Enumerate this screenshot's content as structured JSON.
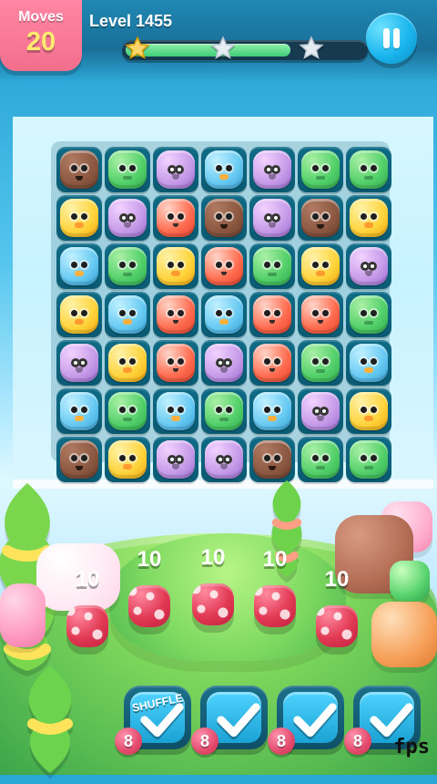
{
  "hud": {
    "moves_label": "Moves",
    "moves_value": "20",
    "level_label": "Level 1455",
    "progress_fraction": 0.69,
    "stars": [
      "gold",
      "silver",
      "silver"
    ]
  },
  "board": {
    "rows": 7,
    "cols": 7,
    "pieces": [
      [
        "bear",
        "frog",
        "owl",
        "bird",
        "owl",
        "frog",
        "frog"
      ],
      [
        "chick",
        "owl",
        "fox",
        "bear",
        "owl",
        "bear",
        "chick"
      ],
      [
        "bird",
        "frog",
        "chick",
        "fox",
        "frog",
        "chick",
        "owl"
      ],
      [
        "chick",
        "bird",
        "fox",
        "bird",
        "fox",
        "fox",
        "frog"
      ],
      [
        "owl",
        "chick",
        "fox",
        "owl",
        "fox",
        "frog",
        "bird"
      ],
      [
        "bird",
        "frog",
        "bird",
        "frog",
        "bird",
        "owl",
        "chick"
      ],
      [
        "bear",
        "chick",
        "owl",
        "owl",
        "bear",
        "frog",
        "frog"
      ]
    ]
  },
  "goals": {
    "items": [
      {
        "count": "10"
      },
      {
        "count": "10"
      },
      {
        "count": "10"
      },
      {
        "count": "10"
      },
      {
        "count": "10"
      }
    ]
  },
  "boosters": {
    "items": [
      {
        "label": "SHUFFLE",
        "count": "8"
      },
      {
        "label": "",
        "count": "8"
      },
      {
        "label": "",
        "count": "8"
      },
      {
        "label": "",
        "count": "8"
      }
    ]
  },
  "overlay": {
    "fps_label": "fps"
  },
  "colors": {
    "moves_bg": "#f06f8f",
    "progress_fill": "#40cc79",
    "pause_button": "#1bb6ee",
    "booster_badge": "#e24a6c"
  },
  "icons": {
    "pause": "pause-icon",
    "star": "star-icon",
    "check": "check-icon"
  }
}
